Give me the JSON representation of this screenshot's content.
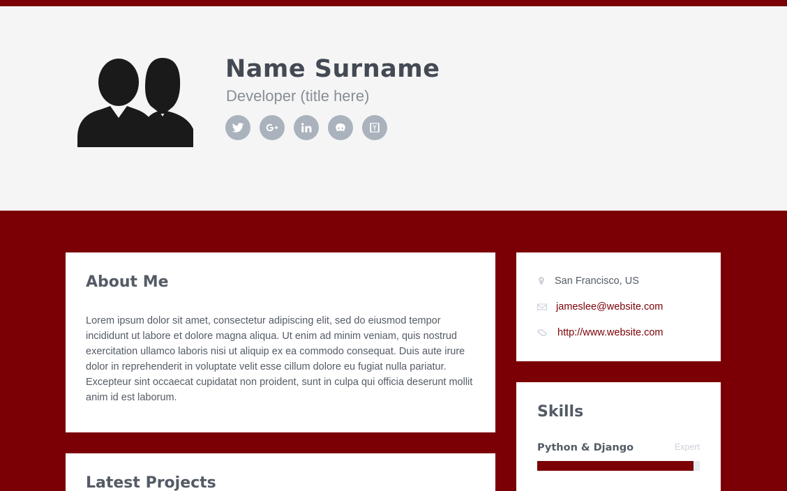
{
  "header": {
    "name": "Name Surname",
    "title": "Developer (title here)",
    "socials": [
      {
        "icon": "twitter-icon"
      },
      {
        "icon": "google-plus-icon"
      },
      {
        "icon": "linkedin-icon"
      },
      {
        "icon": "github-icon"
      },
      {
        "icon": "hacker-news-icon"
      }
    ]
  },
  "about": {
    "heading": "About Me",
    "body": "Lorem ipsum dolor sit amet, consectetur adipiscing elit, sed do eiusmod tempor incididunt ut labore et dolore magna aliqua. Ut enim ad minim veniam, quis nostrud exercitation ullamco laboris nisi ut aliquip ex ea commodo consequat. Duis aute irure dolor in reprehenderit in voluptate velit esse cillum dolore eu fugiat nulla pariatur. Excepteur sint occaecat cupidatat non proident, sunt in culpa qui officia deserunt mollit anim id est laborum."
  },
  "projects": {
    "heading": "Latest Projects"
  },
  "info": {
    "location": "San Francisco, US",
    "email": "jameslee@website.com",
    "website": "http://www.website.com"
  },
  "skills": {
    "heading": "Skills",
    "items": [
      {
        "name": "Python & Django",
        "level": "Expert",
        "percent": 96
      }
    ]
  },
  "colors": {
    "accent": "#7a0006",
    "text": "#545b65",
    "icon_bg": "#aab2bd"
  }
}
